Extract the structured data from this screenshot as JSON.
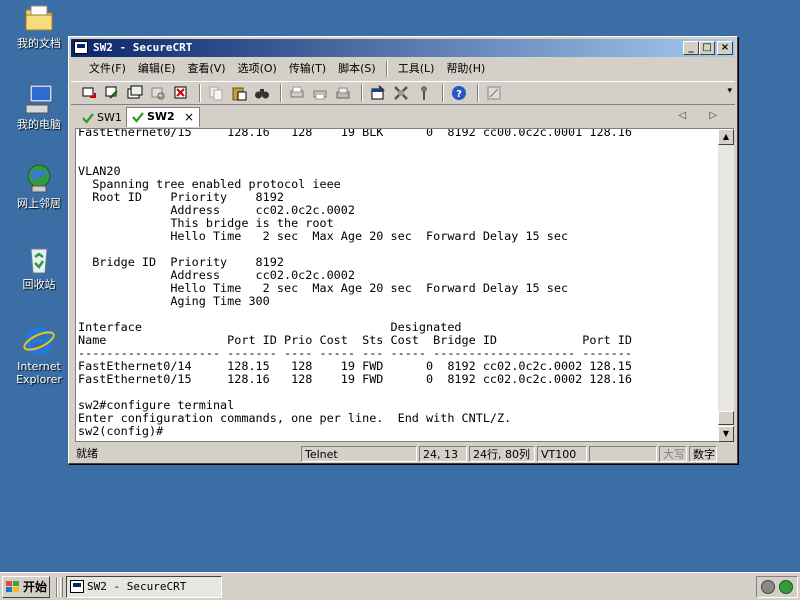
{
  "desktop": {
    "icons": [
      {
        "label": "我的文档"
      },
      {
        "label": "我的电脑"
      },
      {
        "label": "网上邻居"
      },
      {
        "label": "回收站"
      },
      {
        "label": "Internet Explorer"
      }
    ]
  },
  "window": {
    "title": "SW2 - SecureCRT",
    "buttons": {
      "minimize": "_",
      "maximize": "□",
      "close": "×"
    }
  },
  "menu": {
    "items": [
      "文件(F)",
      "编辑(E)",
      "查看(V)",
      "选项(O)",
      "传输(T)",
      "脚本(S)",
      "工具(L)",
      "帮助(H)"
    ]
  },
  "tabs": {
    "items": [
      {
        "label": "SW1"
      },
      {
        "label": "SW2"
      }
    ],
    "close": "×",
    "nav": "◁ ▷"
  },
  "terminal": {
    "lines": [
      "FastEthernet0/15     128.16   128    19 BLK      0  8192 cc00.0c2c.0001 128.16",
      "",
      "",
      "VLAN20",
      "  Spanning tree enabled protocol ieee",
      "  Root ID    Priority    8192",
      "             Address     cc02.0c2c.0002",
      "             This bridge is the root",
      "             Hello Time   2 sec  Max Age 20 sec  Forward Delay 15 sec",
      "",
      "  Bridge ID  Priority    8192",
      "             Address     cc02.0c2c.0002",
      "             Hello Time   2 sec  Max Age 20 sec  Forward Delay 15 sec",
      "             Aging Time 300",
      "",
      "Interface                                   Designated",
      "Name                 Port ID Prio Cost  Sts Cost  Bridge ID            Port ID",
      "-------------------- ------- ---- ----- --- ----- -------------------- -------",
      "FastEthernet0/14     128.15   128    19 FWD      0  8192 cc02.0c2c.0002 128.15",
      "FastEthernet0/15     128.16   128    19 FWD      0  8192 cc02.0c2c.0002 128.16",
      "",
      "sw2#configure terminal",
      "Enter configuration commands, one per line.  End with CNTL/Z.",
      "sw2(config)#"
    ]
  },
  "status": {
    "ready": "就绪",
    "protocol": "Telnet",
    "cursor": "24, 13",
    "size": "24行, 80列",
    "terminal_type": "VT100",
    "caps": "大写",
    "num": "数字"
  },
  "taskbar": {
    "start": "开始",
    "task": "SW2 - SecureCRT"
  }
}
